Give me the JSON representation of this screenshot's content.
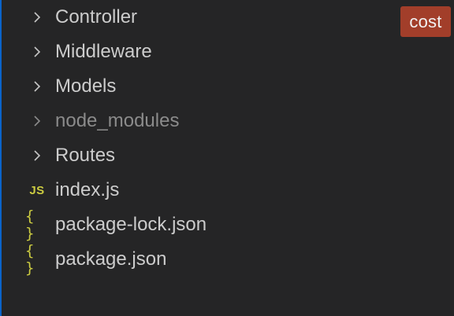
{
  "badge": {
    "label": "cost",
    "color": "#a23e2a"
  },
  "tree": {
    "folders": [
      {
        "label": "Controller",
        "icon": "chevron-right-icon"
      },
      {
        "label": "Middleware",
        "icon": "chevron-right-icon"
      },
      {
        "label": "Models",
        "icon": "chevron-right-icon"
      },
      {
        "label": "node_modules",
        "icon": "chevron-right-icon",
        "dimmed": true
      },
      {
        "label": "Routes",
        "icon": "chevron-right-icon"
      }
    ],
    "files": [
      {
        "label": "index.js",
        "icon": "js-file-icon",
        "glyph": "JS"
      },
      {
        "label": "package-lock.json",
        "icon": "json-file-icon",
        "glyph": "{ }"
      },
      {
        "label": "package.json",
        "icon": "json-file-icon",
        "glyph": "{ }"
      }
    ]
  },
  "colors": {
    "background": "#252526",
    "text": "#cccccc",
    "dimmed_text": "#8b8b8b",
    "file_icon": "#cbcb41",
    "focus_border": "#0a63c9"
  }
}
